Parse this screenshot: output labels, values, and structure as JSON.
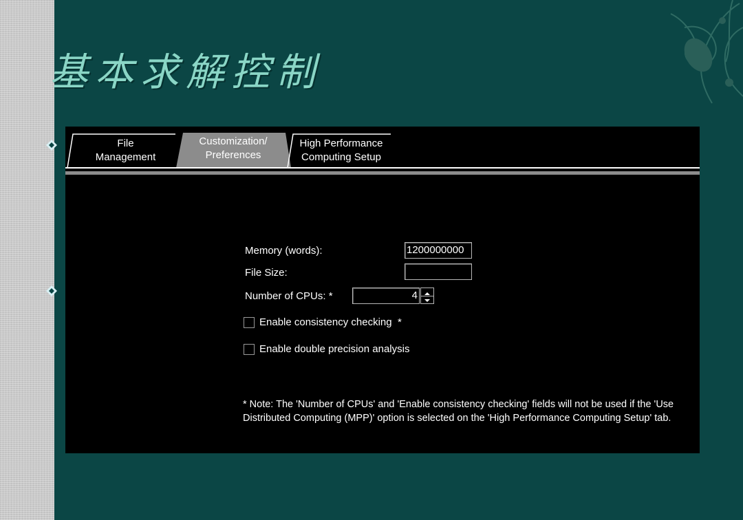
{
  "slide": {
    "title": "基本求解控制"
  },
  "tabs": [
    {
      "line1": "File",
      "line2": "Management"
    },
    {
      "line1": "Customization/",
      "line2": "Preferences"
    },
    {
      "line1": "High Performance",
      "line2": "Computing Setup"
    }
  ],
  "active_tab_index": 1,
  "form": {
    "memory_label": "Memory (words):",
    "memory_value": "1200000000",
    "filesize_label": "File Size:",
    "filesize_value": "",
    "cpus_label": "Number of CPUs: *",
    "cpus_value": "4",
    "consistency_label": "Enable consistency checking  *",
    "consistency_checked": false,
    "double_precision_label": "Enable double precision analysis",
    "double_precision_checked": false
  },
  "note": "* Note: The 'Number of CPUs' and 'Enable consistency checking' fields will not be used if the 'Use Distributed Computing (MPP)' option is selected on the 'High Performance Computing Setup' tab.",
  "colors": {
    "background": "#0b4645",
    "title": "#8ad6c6",
    "panel": "#000000",
    "active_tab": "#8c8c8c"
  },
  "icons": [
    "diamond-bullet-icon",
    "diamond-bullet-icon",
    "floral-ornament-icon",
    "spin-up-icon",
    "spin-down-icon"
  ]
}
